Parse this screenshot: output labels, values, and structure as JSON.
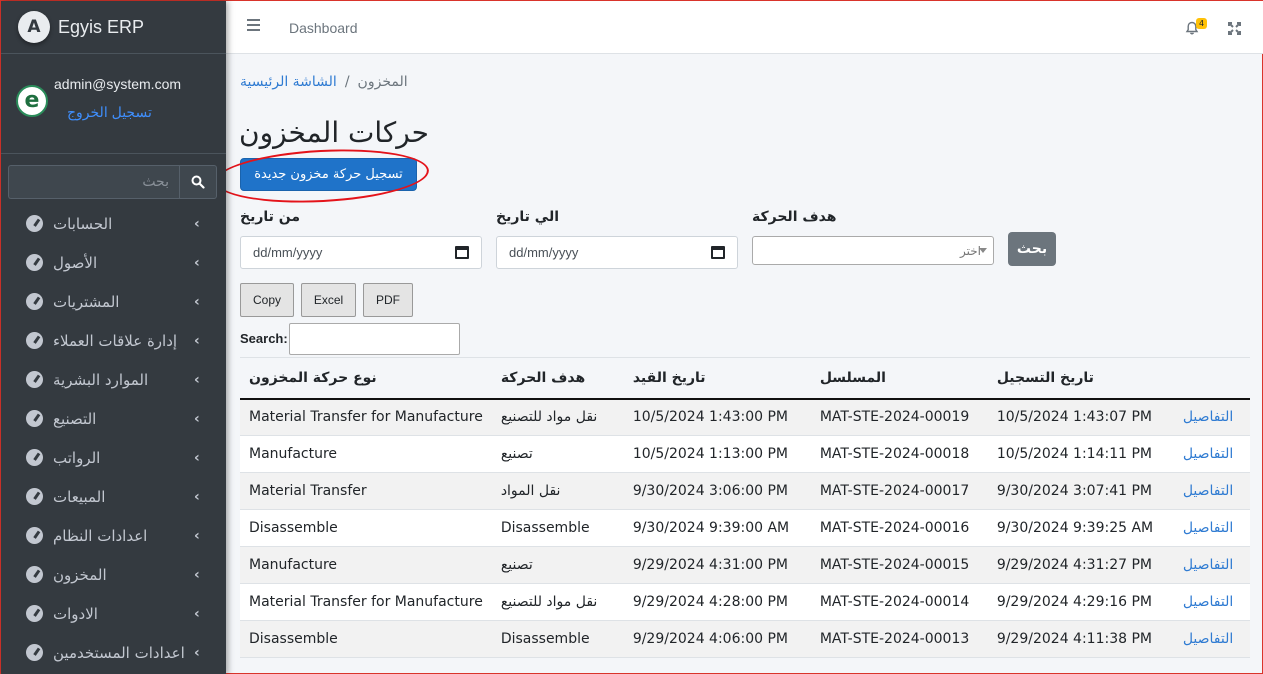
{
  "app": {
    "brand_name": "Egyis ERP",
    "brand_logo_letter": "A"
  },
  "user": {
    "email": "admin@system.com",
    "logout_label": "تسجيل الخروج",
    "avatar_letter": "e"
  },
  "sidebar": {
    "search_placeholder": "بحث",
    "items": [
      {
        "label": "الحسابات"
      },
      {
        "label": "الأصول"
      },
      {
        "label": "المشتريات"
      },
      {
        "label": "إدارة علاقات العملاء"
      },
      {
        "label": "الموارد البشرية"
      },
      {
        "label": "التصنيع"
      },
      {
        "label": "الرواتب"
      },
      {
        "label": "المبيعات"
      },
      {
        "label": "اعدادات النظام"
      },
      {
        "label": "المخزون"
      },
      {
        "label": "الادوات"
      },
      {
        "label": "اعدادات المستخدمين"
      }
    ]
  },
  "topbar": {
    "dashboard_link": "Dashboard",
    "notification_count": "4"
  },
  "breadcrumb": {
    "home": "الشاشة الرئيسية",
    "separator": "/",
    "current": "المخزون"
  },
  "page": {
    "title": "حركات المخزون",
    "new_button": "تسجيل حركة مخزون جديدة"
  },
  "filters": {
    "from_label": "من تاريخ",
    "to_label": "الي تاريخ",
    "purpose_label": "هدف الحركة",
    "date_placeholder": "dd/mm/yyyy",
    "purpose_value": "اختر",
    "search_button": "بحث"
  },
  "export": {
    "copy": "Copy",
    "excel": "Excel",
    "pdf": "PDF",
    "search_label": "Search:"
  },
  "table": {
    "headers": [
      "نوع حركة المخزون",
      "هدف الحركة",
      "تاريخ القيد",
      "المسلسل",
      "تاريخ التسجيل",
      ""
    ],
    "rows": [
      [
        "Material Transfer for Manufacture",
        "نقل مواد للتصنيع",
        "10/5/2024 1:43:00 PM",
        "MAT-STE-2024-00019",
        "10/5/2024 1:43:07 PM",
        "التفاصيل"
      ],
      [
        "Manufacture",
        "تصنيع",
        "10/5/2024 1:13:00 PM",
        "MAT-STE-2024-00018",
        "10/5/2024 1:14:11 PM",
        "التفاصيل"
      ],
      [
        "Material Transfer",
        "نقل المواد",
        "9/30/2024 3:06:00 PM",
        "MAT-STE-2024-00017",
        "9/30/2024 3:07:41 PM",
        "التفاصيل"
      ],
      [
        "Disassemble",
        "Disassemble",
        "9/30/2024 9:39:00 AM",
        "MAT-STE-2024-00016",
        "9/30/2024 9:39:25 AM",
        "التفاصيل"
      ],
      [
        "Manufacture",
        "تصنيع",
        "9/29/2024 4:31:00 PM",
        "MAT-STE-2024-00015",
        "9/29/2024 4:31:27 PM",
        "التفاصيل"
      ],
      [
        "Material Transfer for Manufacture",
        "نقل مواد للتصنيع",
        "9/29/2024 4:28:00 PM",
        "MAT-STE-2024-00014",
        "9/29/2024 4:29:16 PM",
        "التفاصيل"
      ],
      [
        "Disassemble",
        "Disassemble",
        "9/29/2024 4:06:00 PM",
        "MAT-STE-2024-00013",
        "9/29/2024 4:11:38 PM",
        "التفاصيل"
      ]
    ]
  },
  "colors": {
    "sidebar": "#343a40",
    "primary": "#1f73c9",
    "link": "#2f7bd2",
    "annotation": "#e4131a"
  }
}
